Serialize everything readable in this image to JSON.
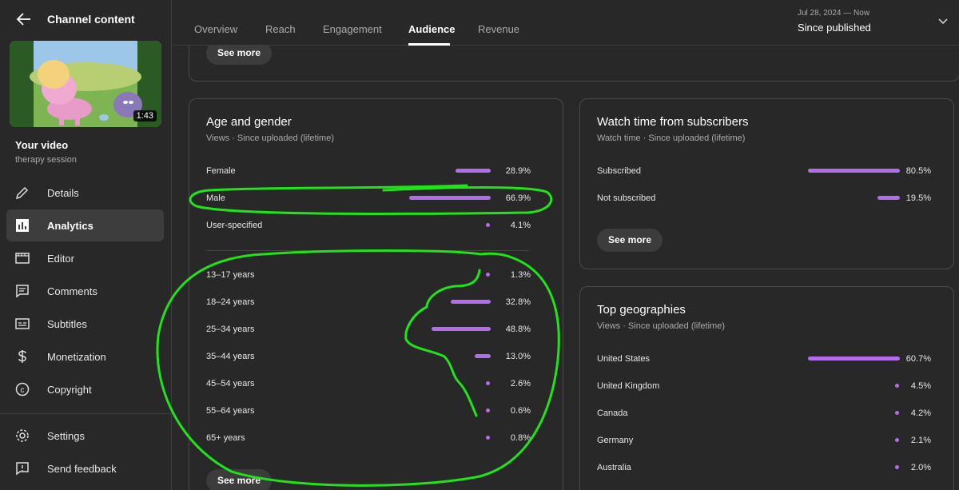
{
  "sidebar": {
    "title": "Channel content",
    "video": {
      "duration": "1:43",
      "label": "Your video",
      "name": "therapy session"
    },
    "nav": [
      {
        "label": "Details",
        "icon": "pencil-icon"
      },
      {
        "label": "Analytics",
        "icon": "analytics-icon",
        "active": true
      },
      {
        "label": "Editor",
        "icon": "editor-icon"
      },
      {
        "label": "Comments",
        "icon": "comments-icon"
      },
      {
        "label": "Subtitles",
        "icon": "subtitles-icon"
      },
      {
        "label": "Monetization",
        "icon": "dollar-icon"
      },
      {
        "label": "Copyright",
        "icon": "copyright-icon"
      }
    ],
    "footer": [
      {
        "label": "Settings",
        "icon": "gear-icon"
      },
      {
        "label": "Send feedback",
        "icon": "feedback-icon"
      }
    ]
  },
  "tabs": [
    {
      "label": "Overview"
    },
    {
      "label": "Reach"
    },
    {
      "label": "Engagement"
    },
    {
      "label": "Audience",
      "active": true
    },
    {
      "label": "Revenue"
    }
  ],
  "date_range": {
    "range": "Jul 28, 2024 — Now",
    "label": "Since published"
  },
  "top_card": {
    "see_more": "See more"
  },
  "age_gender": {
    "title": "Age and gender",
    "subtitle": "Views · Since uploaded (lifetime)",
    "gender": [
      {
        "label": "Female",
        "value": "28.9%",
        "pct": 28.9
      },
      {
        "label": "Male",
        "value": "66.9%",
        "pct": 66.9
      },
      {
        "label": "User-specified",
        "value": "4.1%",
        "pct": 4.1
      }
    ],
    "ages": [
      {
        "label": "13–17 years",
        "value": "1.3%",
        "pct": 1.3
      },
      {
        "label": "18–24 years",
        "value": "32.8%",
        "pct": 32.8
      },
      {
        "label": "25–34 years",
        "value": "48.8%",
        "pct": 48.8
      },
      {
        "label": "35–44 years",
        "value": "13.0%",
        "pct": 13.0
      },
      {
        "label": "45–54 years",
        "value": "2.6%",
        "pct": 2.6
      },
      {
        "label": "55–64 years",
        "value": "0.6%",
        "pct": 0.6
      },
      {
        "label": "65+ years",
        "value": "0.8%",
        "pct": 0.8
      }
    ],
    "see_more": "See more"
  },
  "watch_time": {
    "title": "Watch time from subscribers",
    "subtitle": "Watch time · Since uploaded (lifetime)",
    "rows": [
      {
        "label": "Subscribed",
        "value": "80.5%",
        "pct": 80.5
      },
      {
        "label": "Not subscribed",
        "value": "19.5%",
        "pct": 19.5
      }
    ],
    "see_more": "See more"
  },
  "geographies": {
    "title": "Top geographies",
    "subtitle": "Views · Since uploaded (lifetime)",
    "rows": [
      {
        "label": "United States",
        "value": "60.7%",
        "pct": 60.7
      },
      {
        "label": "United Kingdom",
        "value": "4.5%",
        "pct": 4.5
      },
      {
        "label": "Canada",
        "value": "4.2%",
        "pct": 4.2
      },
      {
        "label": "Germany",
        "value": "2.1%",
        "pct": 2.1
      },
      {
        "label": "Australia",
        "value": "2.0%",
        "pct": 2.0
      }
    ]
  },
  "colors": {
    "accent_bar": "#b06ee8",
    "annotation_stroke": "#22e21a",
    "background": "#282828"
  }
}
